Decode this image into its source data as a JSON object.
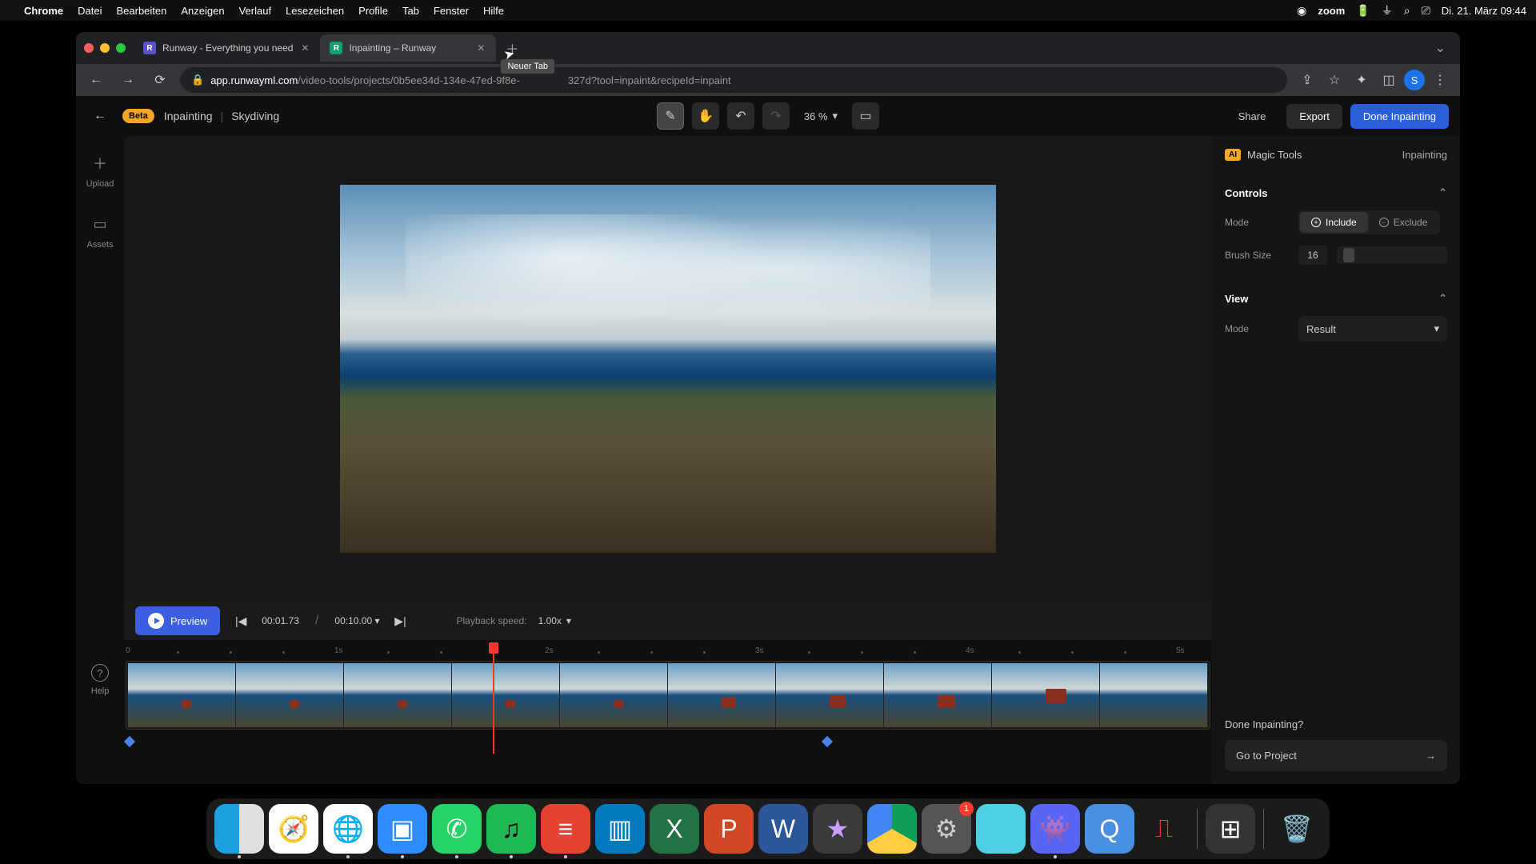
{
  "menubar": {
    "app": "Chrome",
    "items": [
      "Datei",
      "Bearbeiten",
      "Anzeigen",
      "Verlauf",
      "Lesezeichen",
      "Profile",
      "Tab",
      "Fenster",
      "Hilfe"
    ],
    "zoom_label": "zoom",
    "datetime": "Di. 21. März  09:44"
  },
  "tabs": [
    {
      "title": "Runway - Everything you need",
      "active": false
    },
    {
      "title": "Inpainting – Runway",
      "active": true
    }
  ],
  "new_tab_tooltip": "Neuer Tab",
  "url": {
    "host": "app.runwayml.com",
    "path": "/video-tools/projects/0b5ee34d-134e-47ed-9f8e-",
    "tail": "327d?tool=inpaint&recipeId=inpaint"
  },
  "app_header": {
    "beta": "Beta",
    "breadcrumb1": "Inpainting",
    "breadcrumb2": "Skydiving",
    "zoom": "36 %",
    "share": "Share",
    "export": "Export",
    "done": "Done Inpainting"
  },
  "sidebar": {
    "upload": "Upload",
    "assets": "Assets",
    "help": "Help"
  },
  "playback": {
    "preview": "Preview",
    "current": "00:01.73",
    "total": "00:10.00",
    "speed_label": "Playback speed:",
    "speed": "1.00x"
  },
  "timeline": {
    "ticks": [
      "0",
      "1s",
      "2s",
      "3s",
      "4s",
      "5s"
    ]
  },
  "panel": {
    "magic": "Magic Tools",
    "right_label": "Inpainting",
    "controls": "Controls",
    "mode_label": "Mode",
    "include": "Include",
    "exclude": "Exclude",
    "brush_label": "Brush Size",
    "brush_val": "16",
    "view": "View",
    "view_mode_label": "Mode",
    "view_mode_val": "Result",
    "done_q": "Done Inpainting?",
    "goto": "Go to Project"
  },
  "dock_badge_settings": "1",
  "profile_initial": "S"
}
